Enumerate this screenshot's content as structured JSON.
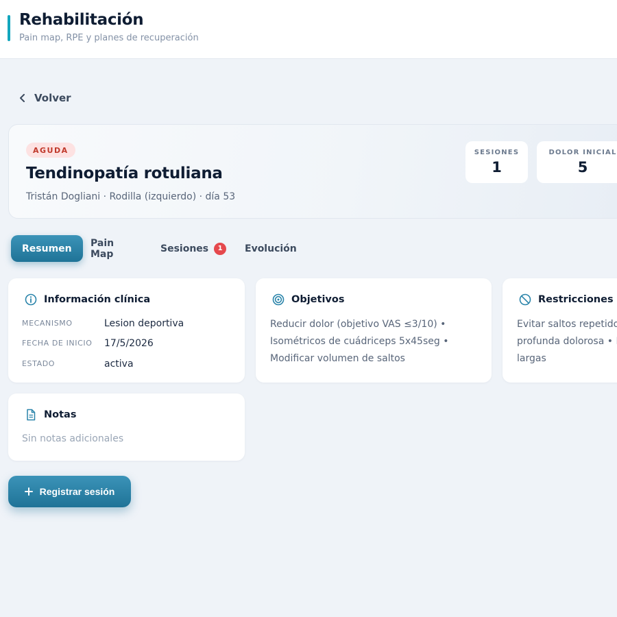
{
  "app": {
    "title": "Rehabilitación",
    "subtitle": "Pain map, RPE y planes de recuperación"
  },
  "nav": {
    "back_label": "Volver",
    "back_icon": "chevron-left-icon"
  },
  "injury": {
    "severity_badge": "AGUDA",
    "title": "Tendinopatía rotuliana",
    "meta": "Tristán Dogliani · Rodilla (izquierdo) · día 53",
    "stats": [
      {
        "label": "SESIONES",
        "value": "1"
      },
      {
        "label": "DOLOR INICIAL",
        "value": "5"
      }
    ]
  },
  "tabs": [
    {
      "label": "Resumen",
      "active": true
    },
    {
      "label": "Pain Map",
      "active": false
    },
    {
      "label": "Sesiones",
      "active": false,
      "count": "1"
    },
    {
      "label": "Evolución",
      "active": false
    }
  ],
  "clinical_info": {
    "title": "Información clínica",
    "icon": "info-icon",
    "rows": [
      {
        "label": "MECANISMO",
        "value": "Lesion deportiva"
      },
      {
        "label": "FECHA DE INICIO",
        "value": "17/5/2026"
      },
      {
        "label": "ESTADO",
        "value": "activa"
      }
    ]
  },
  "objectives": {
    "title": "Objetivos",
    "icon": "target-icon",
    "lines": [
      "Reducir dolor (objetivo VAS ≤3/10) •",
      "Isométricos de cuádriceps 5x45seg •",
      "Modificar volumen de saltos"
    ]
  },
  "restrictions": {
    "title": "Restricciones",
    "icon": "ban-icon",
    "lines": [
      "Evitar saltos repetidos",
      "profunda dolorosa • E",
      "largas"
    ]
  },
  "notes": {
    "title": "Notas",
    "icon": "document-icon",
    "empty_text": "Sin notas adicionales"
  },
  "actions": {
    "register_session": "Registrar sesión",
    "register_icon": "plus-icon"
  },
  "colors": {
    "accent": "#12a6bd",
    "primary": "#2a84aa",
    "badge_bg": "#fde2e2",
    "badge_text": "#c0392b",
    "count_badge": "#e5484d",
    "background": "#eff3f8"
  }
}
